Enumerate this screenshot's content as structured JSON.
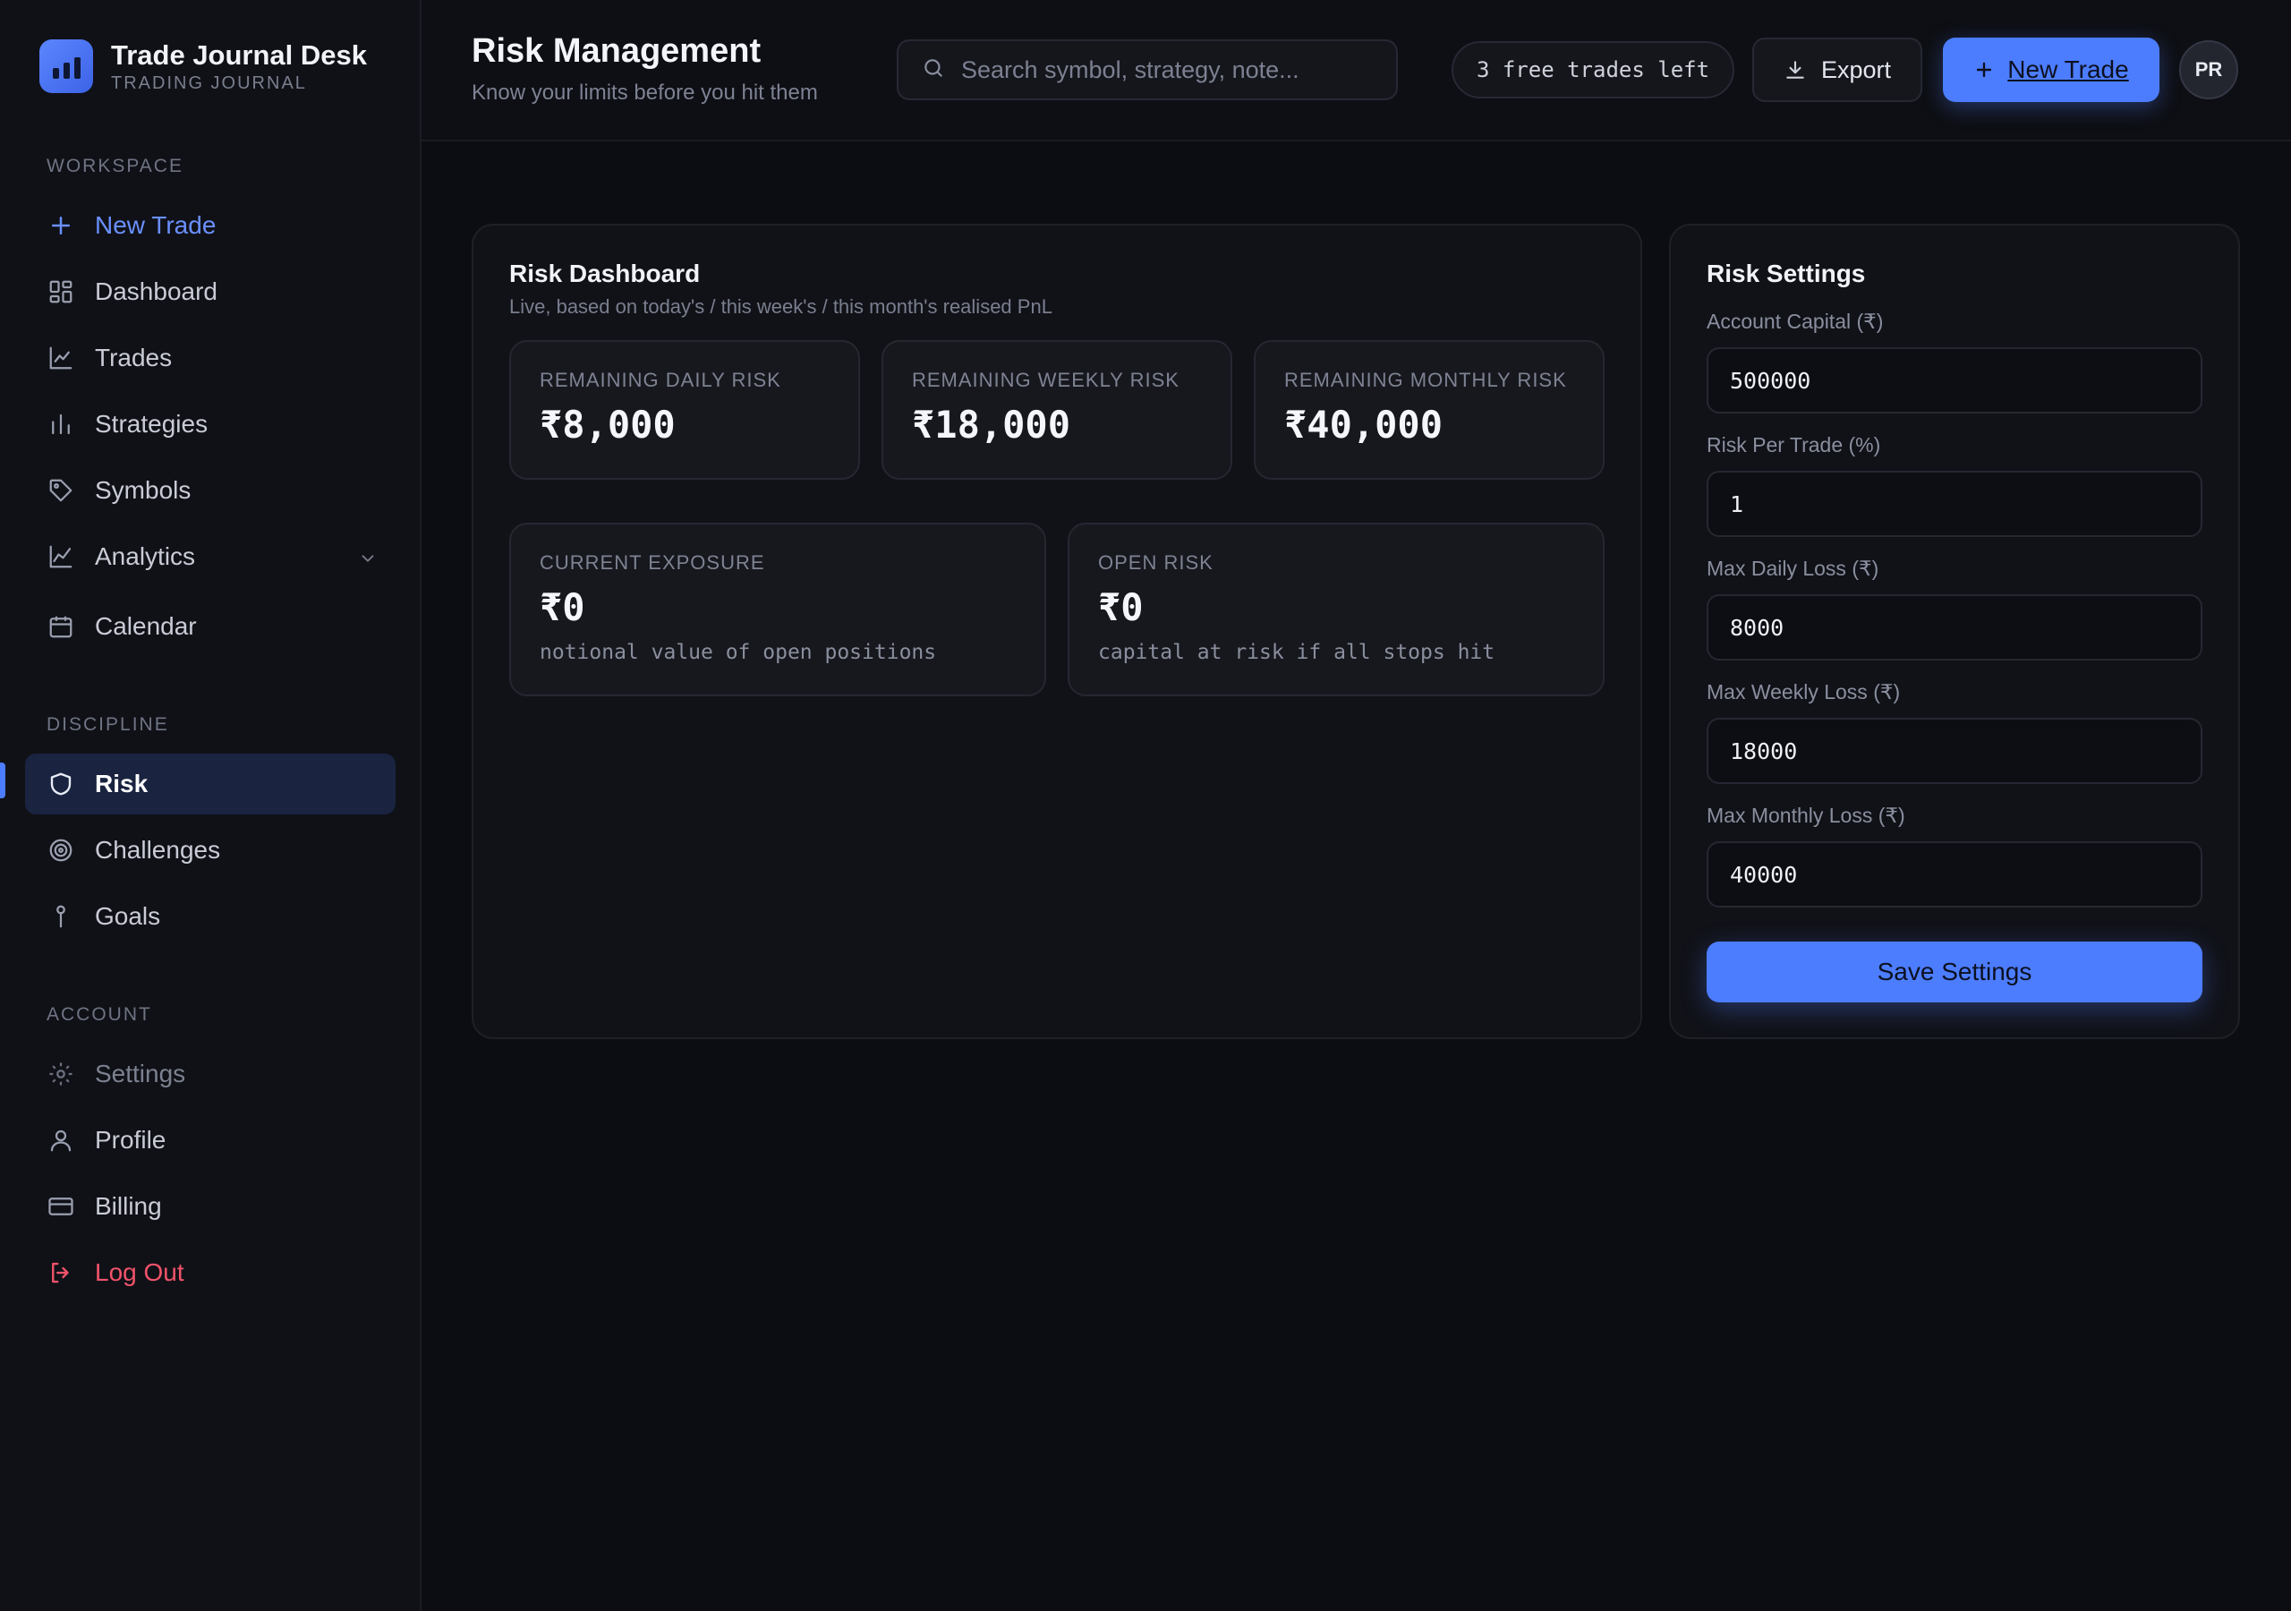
{
  "brand": {
    "name": "Trade Journal Desk",
    "subtitle": "TRADING JOURNAL"
  },
  "sidebar": {
    "sections": {
      "workspace": "WORKSPACE",
      "discipline": "DISCIPLINE",
      "account": "ACCOUNT"
    },
    "items": {
      "new_trade": "New Trade",
      "dashboard": "Dashboard",
      "trades": "Trades",
      "strategies": "Strategies",
      "symbols": "Symbols",
      "analytics": "Analytics",
      "calendar": "Calendar",
      "risk": "Risk",
      "challenges": "Challenges",
      "goals": "Goals",
      "settings": "Settings",
      "profile": "Profile",
      "billing": "Billing",
      "logout": "Log Out"
    },
    "active_item": "Risk"
  },
  "header": {
    "title": "Risk Management",
    "subtitle": "Know your limits before you hit them",
    "search_placeholder": "Search symbol, strategy, note...",
    "free_trades": "3 free trades left",
    "export_label": "Export",
    "new_trade_label": "New Trade",
    "avatar_initials": "PR"
  },
  "risk_dashboard": {
    "title": "Risk Dashboard",
    "subtitle": "Live, based on today's / this week's / this month's realised PnL",
    "remaining": [
      {
        "label": "REMAINING DAILY RISK",
        "value": "₹8,000"
      },
      {
        "label": "REMAINING WEEKLY RISK",
        "value": "₹18,000"
      },
      {
        "label": "REMAINING MONTHLY RISK",
        "value": "₹40,000"
      }
    ],
    "exposure": [
      {
        "label": "CURRENT EXPOSURE",
        "value": "₹0",
        "note": "notional value of open positions"
      },
      {
        "label": "OPEN RISK",
        "value": "₹0",
        "note": "capital at risk if all stops hit"
      }
    ]
  },
  "risk_settings": {
    "title": "Risk Settings",
    "fields": [
      {
        "label": "Account Capital (₹)",
        "value": "500000"
      },
      {
        "label": "Risk Per Trade (%)",
        "value": "1"
      },
      {
        "label": "Max Daily Loss (₹)",
        "value": "8000"
      },
      {
        "label": "Max Weekly Loss (₹)",
        "value": "18000"
      },
      {
        "label": "Max Monthly Loss (₹)",
        "value": "40000"
      }
    ],
    "save_label": "Save Settings"
  },
  "colors": {
    "accent": "#4c7dff",
    "danger": "#f2536a",
    "background": "#0c0d12",
    "sidebar": "#101117"
  }
}
